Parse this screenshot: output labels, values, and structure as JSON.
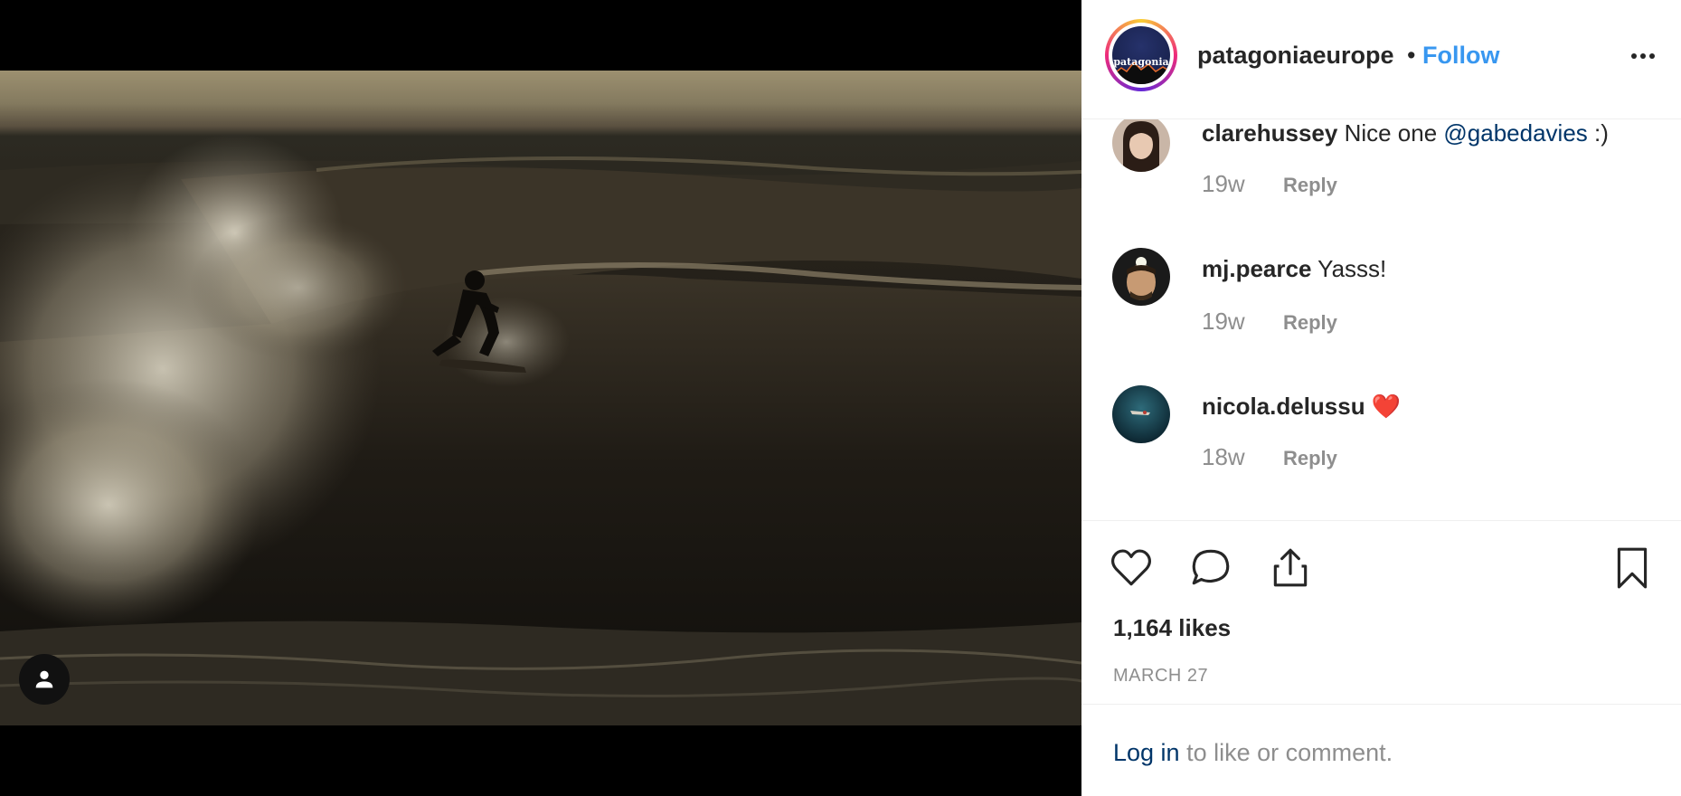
{
  "post": {
    "username": "patagoniaeurope",
    "separator": "•",
    "follow_label": "Follow",
    "avatar_text": "patagonia",
    "more_icon": "more-horizontal-icon"
  },
  "comments": [
    {
      "username": "clarehussey",
      "text": "Nice one ",
      "mention": "@gabedavies",
      "suffix": " :)",
      "time": "19w",
      "reply_label": "Reply"
    },
    {
      "username": "mj.pearce",
      "text": "Yasss!",
      "time": "19w",
      "reply_label": "Reply"
    },
    {
      "username": "nicola.delussu",
      "emoji": "❤️",
      "time": "18w",
      "reply_label": "Reply"
    }
  ],
  "actions": {
    "like_icon": "heart-icon",
    "comment_icon": "comment-icon",
    "share_icon": "share-icon",
    "save_icon": "bookmark-icon"
  },
  "likes": "1,164 likes",
  "date": "MARCH 27",
  "login": {
    "link": "Log in",
    "text": " to like or comment."
  },
  "colors": {
    "link_blue": "#3897f0",
    "mention": "#003569",
    "muted": "#8e8e8e",
    "text": "#262626"
  }
}
